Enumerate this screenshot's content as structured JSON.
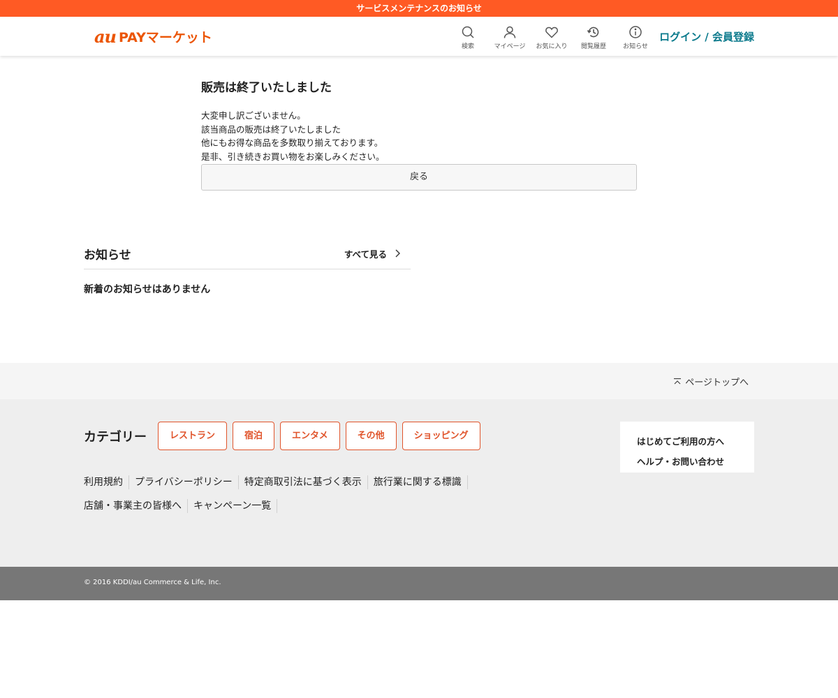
{
  "banner": {
    "text": "サービスメンテナンスのお知らせ"
  },
  "header": {
    "logo_au": "au",
    "logo_rest": "PAYマーケット",
    "nav": [
      {
        "label": "検索",
        "icon": "search-icon"
      },
      {
        "label": "マイページ",
        "icon": "user-icon"
      },
      {
        "label": "お気に入り",
        "icon": "heart-icon"
      },
      {
        "label": "閲覧履歴",
        "icon": "history-icon"
      },
      {
        "label": "お知らせ",
        "icon": "info-icon"
      }
    ],
    "login": "ログイン / 会員登録"
  },
  "main": {
    "title": "販売は終了いたしました",
    "lines": [
      "大変申し訳ございません。",
      "該当商品の販売は終了いたしました",
      "他にもお得な商品を多数取り揃えております。",
      "是非、引き続きお買い物をお楽しみください。"
    ],
    "back_button": "戻る"
  },
  "news": {
    "title": "お知らせ",
    "see_all": "すべて見る",
    "empty": "新着のお知らせはありません"
  },
  "page_top": {
    "label": "ページトップへ"
  },
  "footer": {
    "category_label": "カテゴリー",
    "categories": [
      "レストラン",
      "宿泊",
      "エンタメ",
      "その他",
      "ショッピング"
    ],
    "links_row1": [
      "利用規約",
      "プライバシーポリシー",
      "特定商取引法に基づく表示",
      "旅行業に関する標識"
    ],
    "links_row2": [
      "店舗・事業主の皆様へ",
      "キャンペーン一覧"
    ],
    "help_links": [
      "はじめてご利用の方へ",
      "ヘルプ・お問い合わせ"
    ],
    "copyright": "© 2016 KDDI/au Commerce & Life, Inc."
  },
  "colors": {
    "banner": "#ff5a24",
    "logo": "#eb5505",
    "login": "#0b7a8c",
    "category_accent": "#e0542b",
    "copyright_bar": "#777777"
  }
}
